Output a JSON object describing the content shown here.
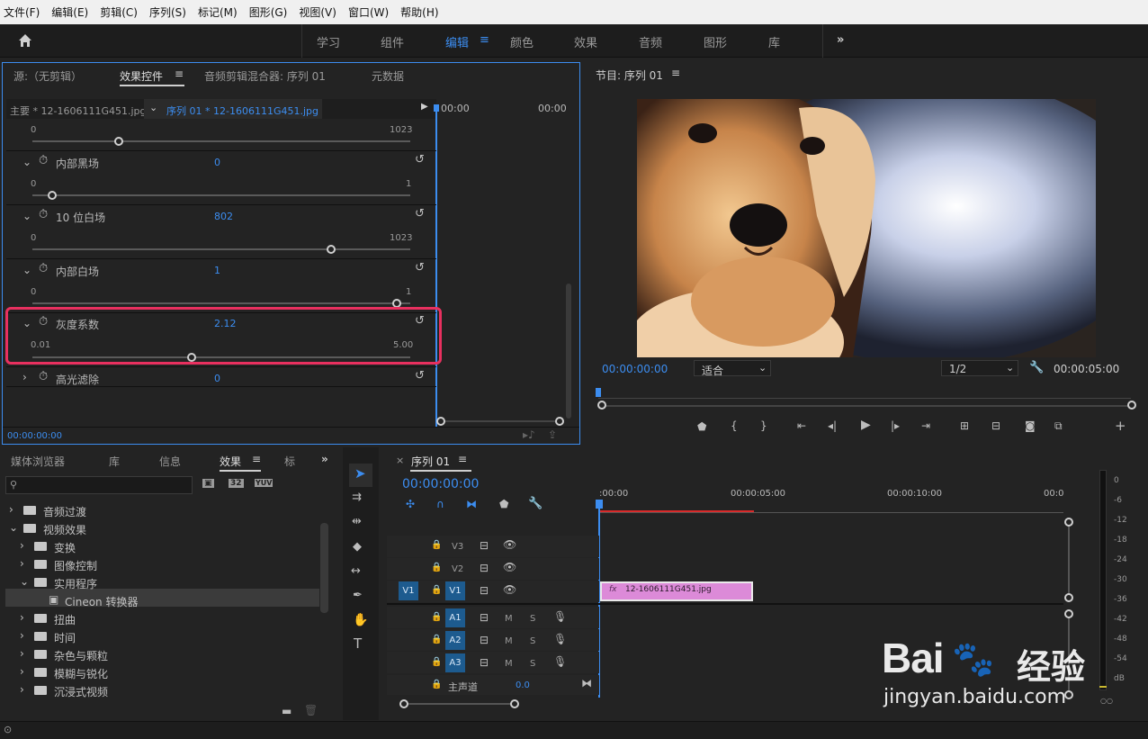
{
  "menu": [
    "文件(F)",
    "编辑(E)",
    "剪辑(C)",
    "序列(S)",
    "标记(M)",
    "图形(G)",
    "视图(V)",
    "窗口(W)",
    "帮助(H)"
  ],
  "workspaces": [
    "学习",
    "组件",
    "编辑",
    "颜色",
    "效果",
    "音频",
    "图形",
    "库"
  ],
  "active_workspace": "编辑",
  "effect_panel": {
    "tabs": [
      "源:（无剪辑）",
      "效果控件",
      "音频剪辑混合器: 序列 01",
      "元数据"
    ],
    "master": "主要 * 12-1606111G451.jpg",
    "sequence": "序列 01 * 12-1606111G451.jpg",
    "ruler": [
      "00:00",
      "00:00"
    ],
    "params": [
      {
        "min": "0",
        "max": "1023"
      },
      {
        "name": "内部黑场",
        "value": "0",
        "min": "0",
        "max": "1"
      },
      {
        "name": "10 位白场",
        "value": "802",
        "min": "0",
        "max": "1023"
      },
      {
        "name": "内部白场",
        "value": "1",
        "min": "0",
        "max": "1"
      },
      {
        "name": "灰度系数",
        "value": "2.12",
        "min": "0.01",
        "max": "5.00"
      },
      {
        "name": "高光滤除",
        "value": "0"
      }
    ],
    "timecode": "00:00:00:00"
  },
  "program": {
    "title": "节目: 序列 01",
    "timecode": "00:00:00:00",
    "fit": "适合",
    "res": "1/2",
    "duration": "00:00:05:00"
  },
  "effects_browser": {
    "tabs": [
      "媒体浏览器",
      "库",
      "信息",
      "效果",
      "标"
    ],
    "badges": [
      "32",
      "YUV"
    ],
    "tree": [
      {
        "label": "音频过渡",
        "level": 0,
        "exp": "›"
      },
      {
        "label": "视频效果",
        "level": 0,
        "exp": "⌄"
      },
      {
        "label": "变换",
        "level": 1,
        "exp": "›"
      },
      {
        "label": "图像控制",
        "level": 1,
        "exp": "›"
      },
      {
        "label": "实用程序",
        "level": 1,
        "exp": "⌄"
      },
      {
        "label": "Cineon 转换器",
        "level": 2,
        "exp": ""
      },
      {
        "label": "扭曲",
        "level": 1,
        "exp": "›"
      },
      {
        "label": "时间",
        "level": 1,
        "exp": "›"
      },
      {
        "label": "杂色与颗粒",
        "level": 1,
        "exp": "›"
      },
      {
        "label": "模糊与锐化",
        "level": 1,
        "exp": "›"
      },
      {
        "label": "沉浸式视频",
        "level": 1,
        "exp": "›"
      }
    ]
  },
  "timeline": {
    "title": "序列 01",
    "timecode": "00:00:00:00",
    "ruler": [
      ":00:00",
      "00:00:05:00",
      "00:00:10:00",
      "00:0"
    ],
    "tracks": {
      "v3": "V3",
      "v2": "V2",
      "v1src": "V1",
      "v1": "V1",
      "a1": "A1",
      "a2": "A2",
      "a3": "A3",
      "m": "M",
      "s": "S",
      "master": "主声道",
      "master_val": "0.0"
    },
    "clip": "12-1606111G451.jpg"
  },
  "meter": {
    "ticks": [
      "0",
      "-6",
      "-12",
      "-18",
      "-24",
      "-30",
      "-36",
      "-42",
      "-48",
      "-54",
      "dB"
    ]
  },
  "watermark": {
    "brand": "Bai",
    "cn": "经验",
    "url": "jingyan.baidu.com"
  }
}
